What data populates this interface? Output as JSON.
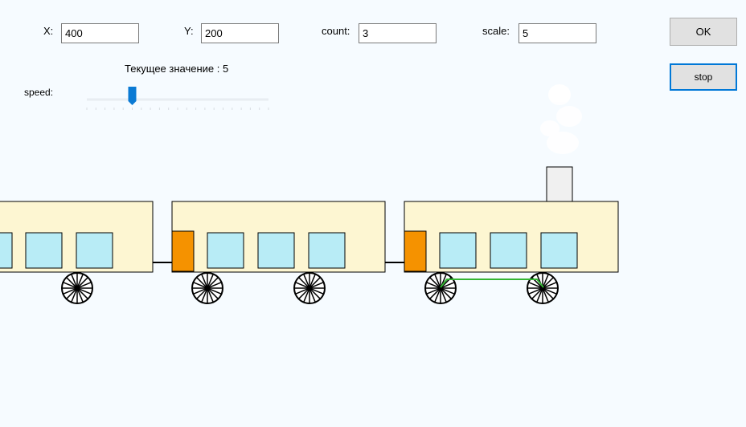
{
  "fields": {
    "x": {
      "label": "X:",
      "value": "400"
    },
    "y": {
      "label": "Y:",
      "value": "200"
    },
    "count": {
      "label": "count:",
      "value": "3"
    },
    "scale": {
      "label": "scale:",
      "value": "5"
    }
  },
  "buttons": {
    "ok": "OK",
    "stop": "stop"
  },
  "current_value_text": "Текущее значение : 5",
  "speed": {
    "label": "speed:",
    "value": 5,
    "min": 0,
    "max": 20
  },
  "colors": {
    "background": "#f6fbff",
    "car_body": "#fdf6d2",
    "window": "#b8ecf6",
    "door": "#f59200",
    "chimney": "#f0f0f0",
    "coupling_rod": "#33b533",
    "slider_thumb": "#0a7ad4",
    "accent": "#0078d7"
  }
}
